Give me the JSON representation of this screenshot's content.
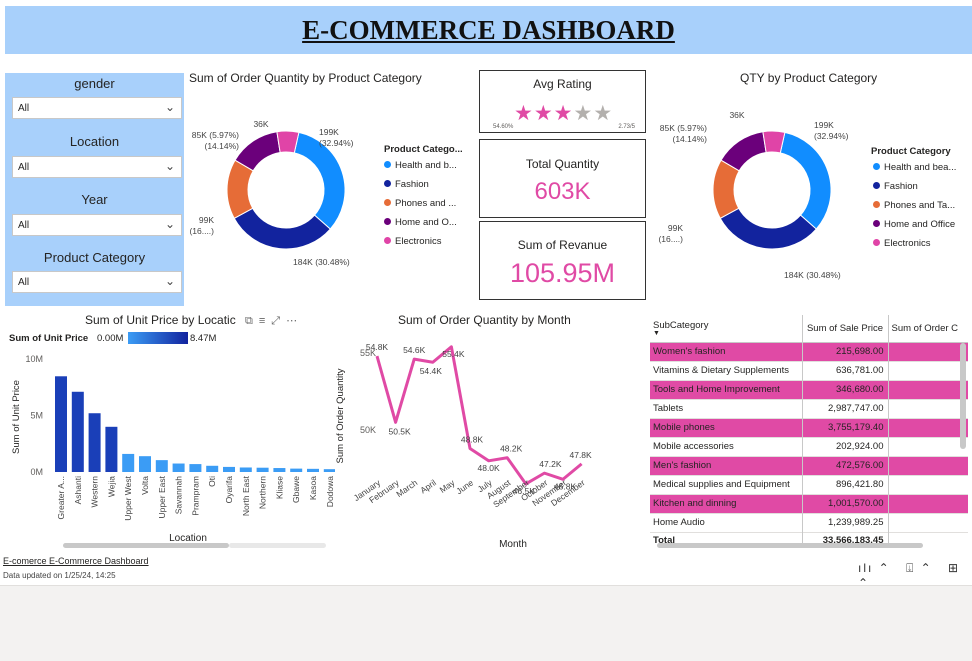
{
  "title": "E-COMMERCE DASHBOARD",
  "slicers": [
    {
      "label": "gender",
      "value": "All"
    },
    {
      "label": "Location",
      "value": "All"
    },
    {
      "label": "Year",
      "value": "All"
    },
    {
      "label": "Product Category",
      "value": "All"
    }
  ],
  "colors": {
    "health": "#118dff",
    "fashion": "#12239e",
    "phones": "#e66c37",
    "home": "#6b007b",
    "electronics": "#e044a7",
    "accent": "#e04aa5",
    "bar_dark": "#1a3fb8",
    "bar_light": "#3b9cf5"
  },
  "donut1": {
    "title": "Sum of Order Quantity by Product Category",
    "legend_title": "Product Catego...",
    "legend_items": [
      "Health and b...",
      "Fashion",
      "Phones and ...",
      "Home and O...",
      "Electronics"
    ],
    "labels": [
      "199K\n(32.94%)",
      "184K (30.48%)",
      "99K\n(16....)",
      "85K (5.97%)\n(14.14%)",
      "36K"
    ]
  },
  "donut2": {
    "title": "QTY by Product Category",
    "legend_title": "Product Category",
    "legend_items": [
      "Health and bea...",
      "Fashion",
      "Phones and Ta...",
      "Home and Office",
      "Electronics"
    ],
    "labels": [
      "199K\n(32.94%)",
      "184K (30.48%)",
      "99K\n(16....)",
      "85K (5.97%)\n(14.14%)",
      "36K"
    ]
  },
  "rating_card": {
    "label": "Avg Rating",
    "min_label": "54.60%",
    "max_label": "2.73/5",
    "stars_filled": 3,
    "stars_total": 5
  },
  "quantity_card": {
    "label": "Total Quantity",
    "value": "603K"
  },
  "revenue_card": {
    "label": "Sum of Revanue",
    "value": "105.95M"
  },
  "unit_price_chart": {
    "title": "Sum of Unit Price by Locatic",
    "legend_label": "Sum of Unit Price",
    "legend_min": "0.00M",
    "legend_max": "8.47M",
    "ylabel": "Sum of Unit Price",
    "xlabel": "Location",
    "y_ticks": [
      "10M",
      "5M",
      "0M"
    ]
  },
  "month_chart": {
    "title": "Sum of Order Quantity by Month",
    "ylabel": "Sum of Order Quantity",
    "xlabel": "Month",
    "y_ticks": [
      "55K",
      "50K"
    ]
  },
  "chart_data": [
    {
      "type": "pie",
      "title": "Sum of Order Quantity by Product Category",
      "categories": [
        "Health and beauty",
        "Fashion",
        "Phones and Tablets",
        "Home and Office",
        "Electronics"
      ],
      "values": [
        199,
        184,
        99,
        85,
        36
      ],
      "percents": [
        32.94,
        30.48,
        16.4,
        14.14,
        5.97
      ]
    },
    {
      "type": "pie",
      "title": "QTY by Product Category",
      "categories": [
        "Health and beauty",
        "Fashion",
        "Phones and Tablets",
        "Home and Office",
        "Electronics"
      ],
      "values": [
        199,
        184,
        99,
        85,
        36
      ],
      "percents": [
        32.94,
        30.48,
        16.4,
        14.14,
        5.97
      ]
    },
    {
      "type": "bar",
      "title": "Sum of Unit Price by Location",
      "categories": [
        "Greater A...",
        "Ashanti",
        "Western",
        "Wejia",
        "Upper West",
        "Volta",
        "Upper East",
        "Savannah",
        "Prampram",
        "Oti",
        "Oyarifa",
        "North East",
        "Northern",
        "Kliase",
        "Gbawe",
        "Kasoa",
        "Dodowa"
      ],
      "values": [
        8.47,
        7.1,
        5.2,
        4.0,
        1.6,
        1.4,
        1.05,
        0.75,
        0.7,
        0.55,
        0.45,
        0.4,
        0.38,
        0.35,
        0.3,
        0.28,
        0.25
      ],
      "ylim": [
        0,
        10
      ],
      "unit": "M"
    },
    {
      "type": "line",
      "title": "Sum of Order Quantity by Month",
      "categories": [
        "January",
        "February",
        "March",
        "April",
        "May",
        "June",
        "July",
        "August",
        "September",
        "October",
        "November",
        "December"
      ],
      "values": [
        54.8,
        50.5,
        54.6,
        54.4,
        55.4,
        48.8,
        48.0,
        48.2,
        46.5,
        47.2,
        46.8,
        47.8
      ],
      "labels": [
        "54.8K",
        "50.5K",
        "54.6K",
        "54.4K",
        "55.4K",
        "48.8K",
        "48.0K",
        "48.2K",
        "46.5K",
        "47.2K",
        "46.8K",
        "47.8K"
      ],
      "ylim": [
        45,
        56
      ],
      "unit": "K"
    }
  ],
  "matrix": {
    "headers": [
      "SubCategory",
      "Sum of Sale Price",
      "Sum of Order C"
    ],
    "rows": [
      {
        "name": "Women's fashion",
        "value": "215,698.00",
        "hl": true
      },
      {
        "name": "Vitamins & Dietary Supplements",
        "value": "636,781.00",
        "hl": false
      },
      {
        "name": "Tools and Home Improvement",
        "value": "346,680.00",
        "hl": true
      },
      {
        "name": "Tablets",
        "value": "2,987,747.00",
        "hl": false
      },
      {
        "name": "Mobile phones",
        "value": "3,755,179.40",
        "hl": true
      },
      {
        "name": "Mobile accessories",
        "value": "202,924.00",
        "hl": false
      },
      {
        "name": "Men's fashion",
        "value": "472,576.00",
        "hl": true
      },
      {
        "name": "Medical supplies and Equipment",
        "value": "896,421.80",
        "hl": false
      },
      {
        "name": "Kitchen and dinning",
        "value": "1,001,570.00",
        "hl": true
      },
      {
        "name": "Home Audio",
        "value": "1,239,989.25",
        "hl": false
      }
    ],
    "total_label": "Total",
    "total_value": "33,566,183.45"
  },
  "footer": {
    "report_name": "E-comerce  E-Commerce Dashboard",
    "updated": "Data updated on 1/25/24, 14:25"
  }
}
